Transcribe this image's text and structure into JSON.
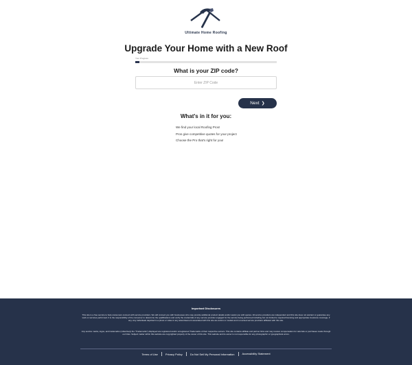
{
  "brand": {
    "logo_text": "Ultimate Home Roofing",
    "logo_icon": "hammer-icon",
    "color": "#26324a"
  },
  "headline": "Upgrade Your Home with a New Roof",
  "progress": {
    "label": "Your Progress",
    "value_percent": 3
  },
  "zip": {
    "question": "What is your ZIP code?",
    "placeholder": "Enter ZIP Code",
    "value": ""
  },
  "next_button": {
    "label": "Next",
    "icon": "chevron-right-icon"
  },
  "whats_in_it": {
    "title": "What's in it for you:",
    "items": [
      "We find your local Roofing Pros!",
      "Pros give competitive quotes for your project",
      "Choose the Pro that's right for you!"
    ]
  },
  "footer": {
    "disclosures_title": "Important Disclosures",
    "paragraph1": "This site is a free service to help consumers connect with service providers. We will connect you with businesses who may provide additional product details and/or assist you with quotes. All service providers are independent and this site does not warrant or guarantee any work or services performed. It is the responsibility of the consumer to determine the qualifications and verify the credentials of any service provider engaged for the service being performed including but not limited to required licensing and appropriate insurance coverage, if any. Any individuals depicted in a photo or video in any advertisement associated with this site are actors or models and not actual service providers affiliated with this site.",
    "paragraph2": "Any service marks, logos, and trademarks (collectively the \"Trademarks\") displayed are registered and/or unregistered Trademarks of their respective owners. This site contains affiliate and partner links and may receive compensation for referrals or purchases made through our links. Subject matter within this website are copyrighted property of the owner of this site. This website and its owner is not responsible for any photographic or typographical errors.",
    "links": {
      "terms": "Terms of Use",
      "privacy": "Privacy Policy",
      "do_not_sell": "Do Not Sell My Personal Information",
      "accessibility": "Accessibility Statement"
    },
    "background": "#26324a"
  }
}
